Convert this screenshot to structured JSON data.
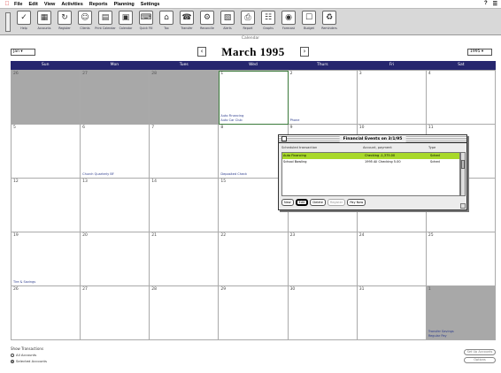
{
  "menubar": {
    "apple": "",
    "menus": [
      "File",
      "Edit",
      "View",
      "Activities",
      "Reports",
      "Planning",
      "Settings"
    ],
    "right_icons": [
      "?",
      "☰"
    ]
  },
  "toolbar": {
    "tools": [
      {
        "icon": "✓",
        "label": "Help",
        "name": "help-icon"
      },
      {
        "icon": "▦",
        "label": "Accounts",
        "name": "accounts-icon"
      },
      {
        "icon": "↻",
        "label": "Register",
        "name": "register-icon"
      },
      {
        "icon": "☺",
        "label": "Clients",
        "name": "clients-icon"
      },
      {
        "icon": "▤",
        "label": "Print Calendar",
        "name": "printer-icon"
      },
      {
        "icon": "▣",
        "label": "Calendar",
        "name": "calendar-icon"
      },
      {
        "icon": "⌨",
        "label": "Quick Fill",
        "name": "keyboard-icon"
      },
      {
        "icon": "⌂",
        "label": "Tax",
        "name": "house-icon"
      },
      {
        "icon": "☎",
        "label": "Transfer",
        "name": "phone-icon"
      },
      {
        "icon": "⚙",
        "label": "Reconcile",
        "name": "gear-icon"
      },
      {
        "icon": "▧",
        "label": "Alerts",
        "name": "list-icon"
      },
      {
        "icon": "⎙",
        "label": "Report",
        "name": "report-icon"
      },
      {
        "icon": "☷",
        "label": "Graphs",
        "name": "graph-icon"
      },
      {
        "icon": "◉",
        "label": "Forecast",
        "name": "globe-icon"
      },
      {
        "icon": "☐",
        "label": "Budget",
        "name": "budget-icon"
      },
      {
        "icon": "♻",
        "label": "Reminders",
        "name": "reminders-icon"
      }
    ]
  },
  "caption": "Calendar",
  "nav": {
    "view_select": "Jan ▾",
    "prev_arrow": "‹",
    "next_arrow": "›",
    "month": "March 1995",
    "year_select": "1995 ▾"
  },
  "calendar": {
    "weekdays": [
      "Sun",
      "Mon",
      "Tues",
      "Wed",
      "Thurs",
      "Fri",
      "Sat"
    ],
    "cells": [
      {
        "day": "26",
        "outside": true,
        "event": ""
      },
      {
        "day": "27",
        "outside": true,
        "event": ""
      },
      {
        "day": "28",
        "outside": true,
        "event": ""
      },
      {
        "day": "1",
        "outside": false,
        "today": true,
        "event": "Auto Financing\nAuto Car Club"
      },
      {
        "day": "2",
        "outside": false,
        "event": "Phone"
      },
      {
        "day": "3",
        "outside": false,
        "event": ""
      },
      {
        "day": "4",
        "outside": false,
        "event": ""
      },
      {
        "day": "5",
        "outside": false,
        "event": ""
      },
      {
        "day": "6",
        "outside": false,
        "event": "Church Quarterly BF"
      },
      {
        "day": "7",
        "outside": false,
        "event": ""
      },
      {
        "day": "8",
        "outside": false,
        "event": "Deposited Check"
      },
      {
        "day": "9",
        "outside": false,
        "event": ""
      },
      {
        "day": "10",
        "outside": false,
        "event": ""
      },
      {
        "day": "11",
        "outside": false,
        "event": ""
      },
      {
        "day": "12",
        "outside": false,
        "event": ""
      },
      {
        "day": "13",
        "outside": false,
        "event": ""
      },
      {
        "day": "14",
        "outside": false,
        "event": ""
      },
      {
        "day": "15",
        "outside": false,
        "event": ""
      },
      {
        "day": "16",
        "outside": false,
        "event": ""
      },
      {
        "day": "17",
        "outside": false,
        "event": ""
      },
      {
        "day": "18",
        "outside": false,
        "event": ""
      },
      {
        "day": "19",
        "outside": false,
        "event": "Tire & Savings"
      },
      {
        "day": "20",
        "outside": false,
        "event": ""
      },
      {
        "day": "21",
        "outside": false,
        "event": ""
      },
      {
        "day": "22",
        "outside": false,
        "event": ""
      },
      {
        "day": "23",
        "outside": false,
        "event": ""
      },
      {
        "day": "24",
        "outside": false,
        "event": ""
      },
      {
        "day": "25",
        "outside": false,
        "event": ""
      },
      {
        "day": "26",
        "outside": false,
        "event": ""
      },
      {
        "day": "27",
        "outside": false,
        "event": ""
      },
      {
        "day": "28",
        "outside": false,
        "event": ""
      },
      {
        "day": "29",
        "outside": false,
        "event": ""
      },
      {
        "day": "30",
        "outside": false,
        "event": ""
      },
      {
        "day": "31",
        "outside": false,
        "event": ""
      },
      {
        "day": "1",
        "outside": true,
        "event": "Transfer Savings\nRegular Pay"
      }
    ]
  },
  "dialog": {
    "title": "Financial Events on 3/1/95",
    "columns": [
      "Scheduled transaction",
      "Account, payment",
      "Type"
    ],
    "rows": [
      {
        "c1": "Auto Financing",
        "c2": "Checking  -1,375.00",
        "c3": "Sched",
        "selected": true
      },
      {
        "c1": "School Bowling",
        "c2": "1995 All Checking  5.00",
        "c3": "Sched",
        "selected": false
      }
    ],
    "buttons": [
      "New",
      "Edit",
      "Delete",
      "Register",
      "Pay Now"
    ],
    "default_button": "Edit",
    "disabled_button": "Register"
  },
  "bottom": {
    "legend": "Show Transactions",
    "options": [
      {
        "label": "All Accounts",
        "checked": false
      },
      {
        "label": "Selected Accounts",
        "checked": true
      }
    ],
    "right_buttons": [
      "Set Up Accounts",
      "Options"
    ]
  },
  "colors": {
    "header_bar": "#26266e",
    "outside_cell": "#a8a8a8",
    "selected_row": "#a8d82a",
    "event_text": "#2a3a8c"
  }
}
